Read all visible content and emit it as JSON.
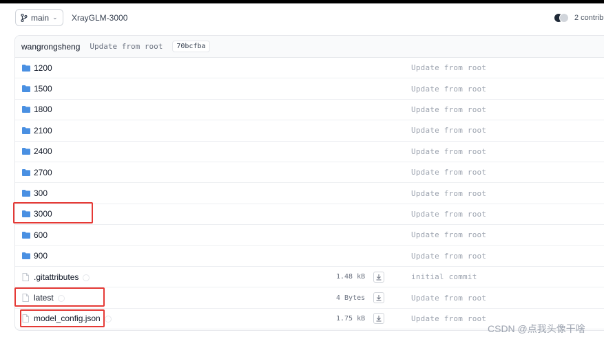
{
  "header": {
    "branch": "main",
    "repo": "XrayGLM-3000",
    "contributors": "2 contribu"
  },
  "commit": {
    "author": "wangrongsheng",
    "message": "Update from root",
    "sha": "70bcfba"
  },
  "files": [
    {
      "name": "1200",
      "type": "folder",
      "size": "",
      "message": "Update from root"
    },
    {
      "name": "1500",
      "type": "folder",
      "size": "",
      "message": "Update from root"
    },
    {
      "name": "1800",
      "type": "folder",
      "size": "",
      "message": "Update from root"
    },
    {
      "name": "2100",
      "type": "folder",
      "size": "",
      "message": "Update from root"
    },
    {
      "name": "2400",
      "type": "folder",
      "size": "",
      "message": "Update from root"
    },
    {
      "name": "2700",
      "type": "folder",
      "size": "",
      "message": "Update from root"
    },
    {
      "name": "300",
      "type": "folder",
      "size": "",
      "message": "Update from root"
    },
    {
      "name": "3000",
      "type": "folder",
      "size": "",
      "message": "Update from root"
    },
    {
      "name": "600",
      "type": "folder",
      "size": "",
      "message": "Update from root"
    },
    {
      "name": "900",
      "type": "folder",
      "size": "",
      "message": "Update from root"
    },
    {
      "name": ".gitattributes",
      "type": "file",
      "size": "1.48 kB",
      "message": "initial commit"
    },
    {
      "name": "latest",
      "type": "file",
      "size": "4 Bytes",
      "message": "Update from root"
    },
    {
      "name": "model_config.json",
      "type": "file",
      "size": "1.75 kB",
      "message": "Update from root"
    }
  ],
  "watermark": "CSDN @点我头像干啥",
  "colors": {
    "folder": "#4a90e2",
    "highlight": "#e53935"
  }
}
